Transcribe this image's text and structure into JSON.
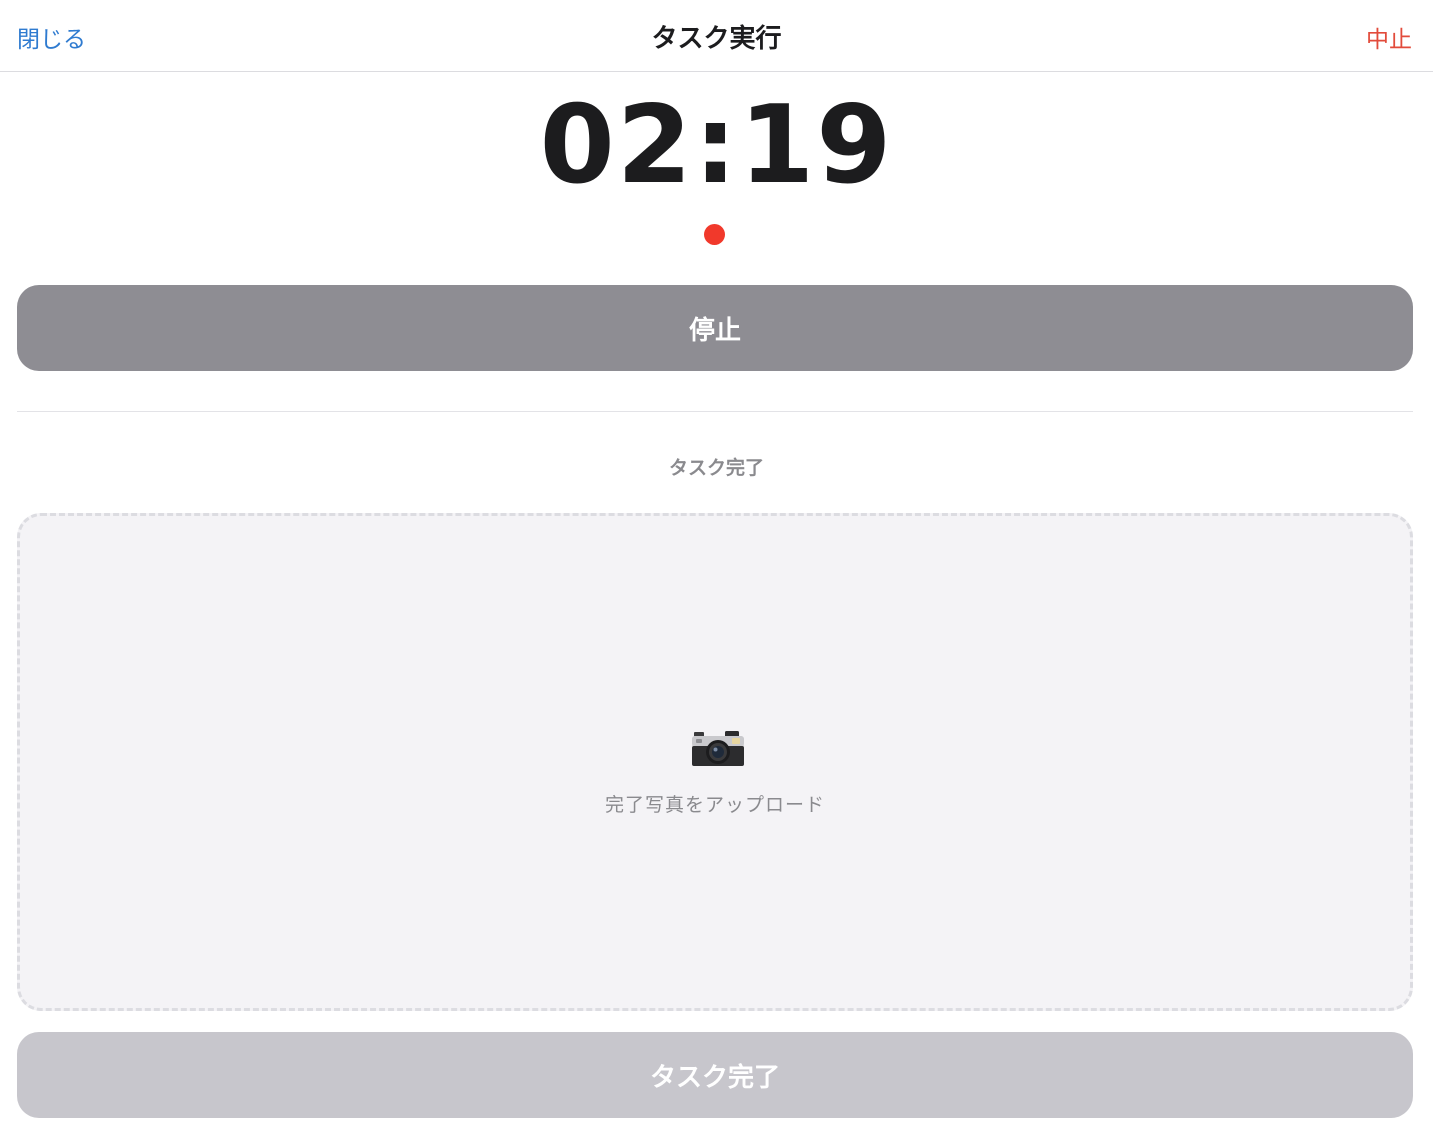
{
  "nav": {
    "close_label": "閉じる",
    "title": "タスク実行",
    "abort_label": "中止"
  },
  "timer": {
    "display": "02:19",
    "recording": true
  },
  "controls": {
    "stop_label": "停止"
  },
  "completion": {
    "section_label": "タスク完了",
    "upload_icon": "camera-icon",
    "upload_text": "完了写真をアップロード",
    "complete_label": "タスク完了",
    "complete_enabled": false
  },
  "colors": {
    "link_blue": "#2f7bd0",
    "abort_red": "#e24b3b",
    "recording_red": "#f1392b",
    "stop_button_gray": "#8e8d93",
    "disabled_button_gray": "#c7c6cc"
  }
}
